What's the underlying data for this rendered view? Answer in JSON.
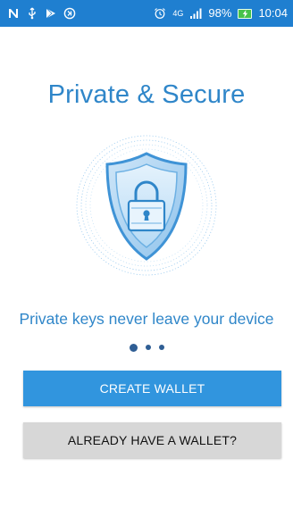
{
  "status_bar": {
    "left_icons": [
      "n-notification-icon",
      "usb-icon",
      "play-store-icon",
      "sync-icon"
    ],
    "alarm_icon": "alarm-clock-icon",
    "network": "4G",
    "signal_icon": "signal-bars-icon",
    "battery_percent": "98%",
    "battery_icon": "battery-charging-icon",
    "time": "10:04",
    "background_color": "#1f7fd0"
  },
  "onboarding": {
    "title": "Private & Secure",
    "illustration_icon": "shield-lock-icon",
    "caption": "Private keys never leave your device",
    "pager": {
      "total": 3,
      "active_index": 0
    }
  },
  "actions": {
    "create_wallet_label": "CREATE WALLET",
    "already_have_label": "ALREADY HAVE A WALLET?"
  },
  "colors": {
    "accent": "#2f86c9",
    "primary_button": "#3195de",
    "secondary_button": "#d7d7d7",
    "pager_dot": "#2f5e94"
  }
}
